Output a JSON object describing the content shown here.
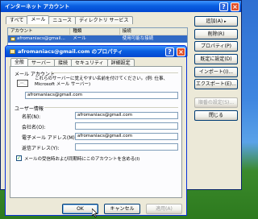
{
  "outer_window": {
    "title": "インターネット アカウント",
    "tabs": [
      {
        "label": "すべて",
        "active": false
      },
      {
        "label": "メール",
        "active": true
      },
      {
        "label": "ニュース",
        "active": false
      },
      {
        "label": "ディレクトリ サービス",
        "active": false
      }
    ],
    "columns": [
      "アカウント",
      "種類",
      "接続"
    ],
    "rows": [
      {
        "account": "afromaniacs@gmail...",
        "type": "メール",
        "connection": "使用可能な接続"
      }
    ],
    "buttons": {
      "add": "追加(A)",
      "remove": "削除(R)",
      "properties": "プロパティ(P)",
      "set_default": "既定に設定(D)",
      "import": "インポート(I)...",
      "export": "エクスポート(E)...",
      "set_order": "順番の設定(S)...",
      "close": "閉じる"
    }
  },
  "dialog": {
    "title": "afromaniacs@gmail.com のプロパティ",
    "tabs": [
      {
        "label": "全般",
        "active": true
      },
      {
        "label": "サーバー",
        "active": false
      },
      {
        "label": "接続",
        "active": false
      },
      {
        "label": "セキュリティ",
        "active": false
      },
      {
        "label": "詳細設定",
        "active": false
      }
    ],
    "mail_account_group": "メール アカウント",
    "mail_account_desc": "これらのサーバーに覚えやすい名前を付けてください。(例: 仕事、Microsoft メール サーバー)",
    "account_name_value": "afromaniacs@gmail.com",
    "user_info_group": "ユーザー情報",
    "fields": [
      {
        "label": "名前(N):",
        "value": "afromaniacs@gmail.com"
      },
      {
        "label": "会社名(O):",
        "value": ""
      },
      {
        "label": "電子メール アドレス(M):",
        "value": "afromaniacs@gmail.com"
      },
      {
        "label": "返信アドレス(Y):",
        "value": ""
      }
    ],
    "include_checkbox_label": "メールの受信時および同期時にこのアカウントを含める(I)",
    "include_checked": true,
    "buttons": {
      "ok": "OK",
      "cancel": "キャンセル",
      "apply": "適用(A)"
    }
  }
}
